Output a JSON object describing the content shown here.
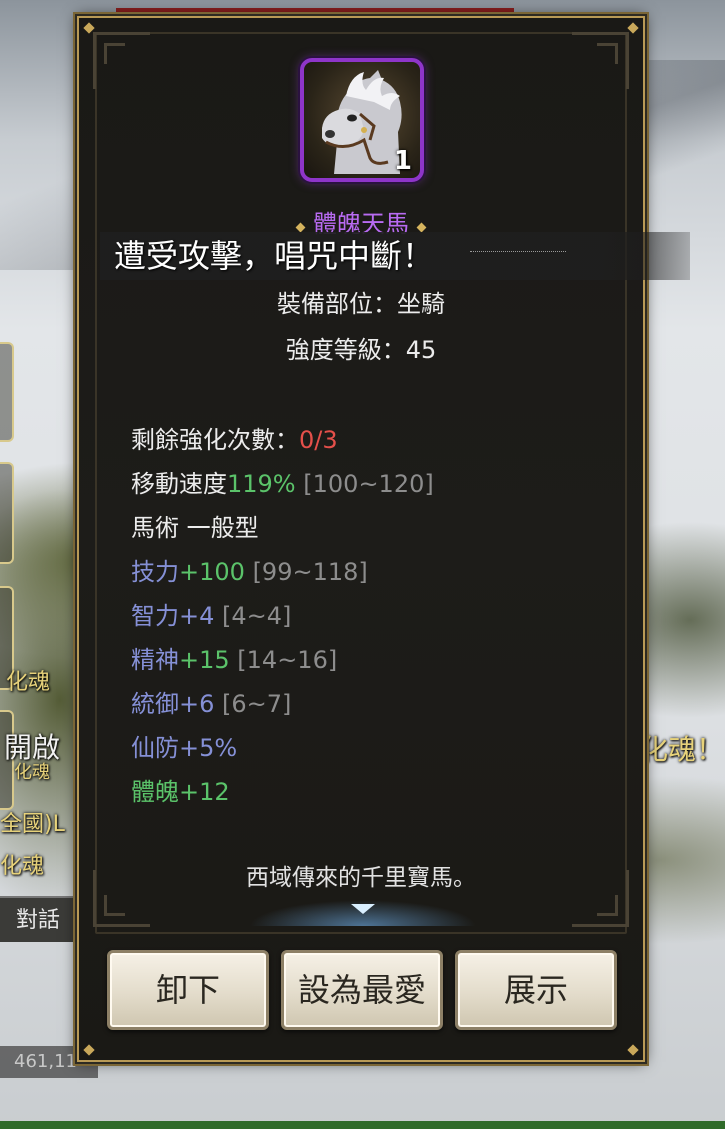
{
  "background": {
    "side_texts": [
      "化魂",
      "開啟",
      "化魂",
      "全國)L",
      "化魂"
    ],
    "right_text": "化魂！",
    "chat_tab_label": "對話",
    "coordinates": "461,11"
  },
  "item": {
    "icon": "white-horse-icon",
    "stack_count": "1",
    "name": "體魄天馬",
    "slot_line": "裝備部位：坐騎",
    "level_line": "強度等級：45",
    "enhance": {
      "label": "剩餘強化次數：",
      "value": "0/3"
    },
    "move_speed": {
      "label": "移動速度",
      "value": "119%",
      "range": "[100~120]"
    },
    "horsemanship": "馬術 一般型",
    "skill": {
      "label": "技力",
      "value": "+100",
      "range": "[99~118]"
    },
    "intellect": {
      "label": "智力",
      "value": "+4",
      "range": "[4~4]"
    },
    "spirit": {
      "label": "精神",
      "value": "+15",
      "range": "[14~16]"
    },
    "command": {
      "label": "統御",
      "value": "+6",
      "range": "[6~7]"
    },
    "immortal_def": "仙防+5%",
    "physique": "體魄+12",
    "description": "西域傳來的千里寶馬。"
  },
  "buttons": {
    "unequip": "卸下",
    "favorite": "設為最愛",
    "showcase": "展示"
  },
  "notice": "遭受攻擊，唱咒中斷！",
  "colors": {
    "name_purple": "#b86bf2",
    "red": "#e4504a",
    "green": "#5bc36a",
    "blue": "#8590d6",
    "gray": "#8d8d8d",
    "frame_gold": "#b99a56"
  }
}
